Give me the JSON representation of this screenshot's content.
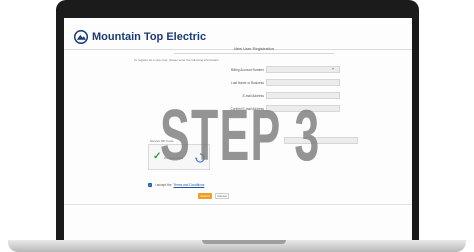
{
  "header": {
    "brand": "Mountain Top Electric",
    "logo_icon": "mountain-logo-icon",
    "brand_color": "#1a3b78"
  },
  "form": {
    "title": "New User Registration",
    "intro": "To register as a new user, please enter the following information",
    "fields": [
      {
        "label": "Billing Account Number",
        "value": "",
        "has_caret": true
      },
      {
        "label": "Last Name or Business",
        "value": ""
      },
      {
        "label": "E-mail Address",
        "value": ""
      },
      {
        "label": "Confirm E-mail Address",
        "value": ""
      }
    ],
    "zip_label": "Service ZIP Code",
    "captcha_label": "I'm not a robot",
    "terms_text": "I accept the",
    "terms_link": "Terms and Conditions",
    "submit_label": "Submit",
    "cancel_label": "Cancel"
  },
  "overlay": {
    "text": "STEP 3"
  },
  "colors": {
    "accent": "#f0a020",
    "link": "#1a56a8",
    "check": "#2e9e3f"
  }
}
